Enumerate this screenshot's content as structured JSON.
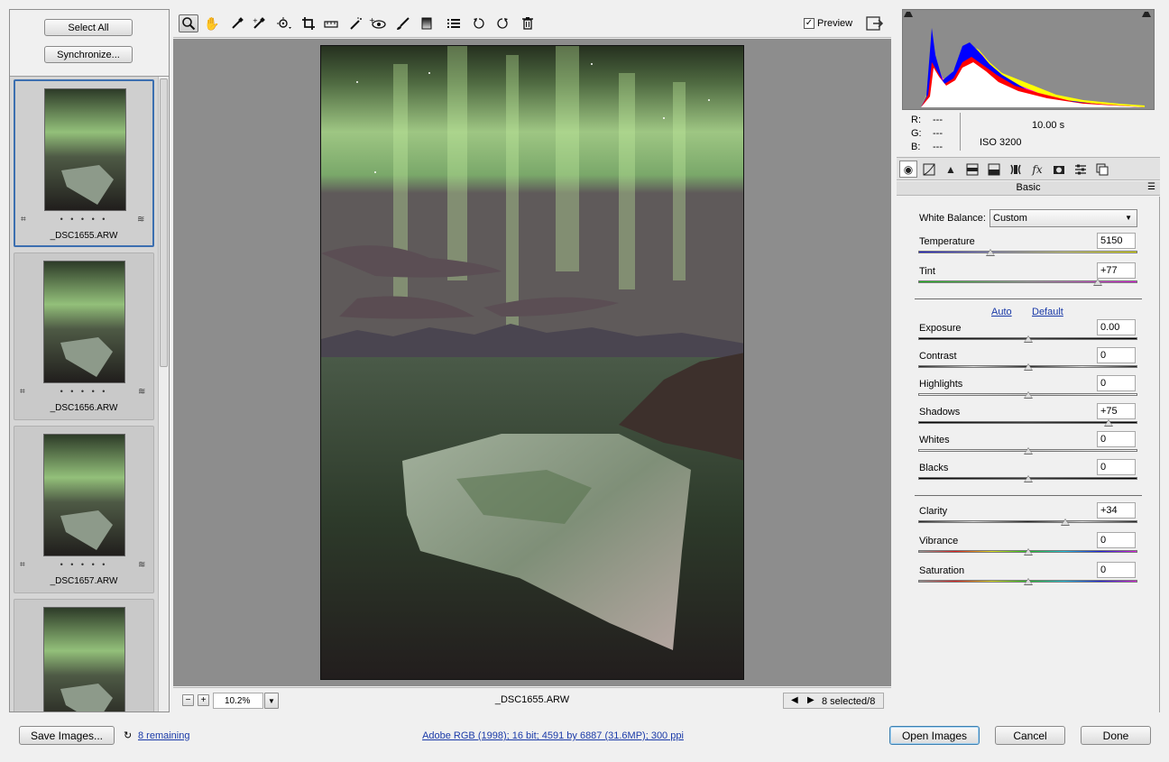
{
  "filmstrip": {
    "select_all": "Select All",
    "synchronize": "Synchronize...",
    "items": [
      {
        "name": "_DSC1655.ARW",
        "rating": "• • • • •",
        "selected": true
      },
      {
        "name": "_DSC1656.ARW",
        "rating": "• • • • •",
        "selected": false
      },
      {
        "name": "_DSC1657.ARW",
        "rating": "• • • • •",
        "selected": false
      },
      {
        "name": "",
        "rating": "",
        "selected": false
      }
    ]
  },
  "toolbar": {
    "preview_label": "Preview",
    "preview_checked": true,
    "tools": [
      "zoom-icon",
      "hand-icon",
      "white-balance-icon",
      "color-sampler-icon",
      "targeted-adjustment-icon",
      "crop-icon",
      "straighten-icon",
      "spot-removal-icon",
      "red-eye-icon",
      "adjustment-brush-icon",
      "graduated-filter-icon",
      "preferences-icon",
      "rotate-left-icon",
      "rotate-right-icon",
      "trash-icon"
    ]
  },
  "status": {
    "zoom": "10.2%",
    "filename": "_DSC1655.ARW",
    "selection": "8 selected/8"
  },
  "info": {
    "r_label": "R:",
    "r_val": "---",
    "g_label": "G:",
    "g_val": "---",
    "b_label": "B:",
    "b_val": "---",
    "shutter": "10.00 s",
    "iso": "ISO 3200"
  },
  "panel": {
    "title": "Basic",
    "white_balance_label": "White Balance:",
    "white_balance_value": "Custom",
    "auto_link": "Auto",
    "default_link": "Default",
    "sliders": [
      {
        "label": "Temperature",
        "value": "5150",
        "pos": 0.33,
        "track": "temp"
      },
      {
        "label": "Tint",
        "value": "+77",
        "pos": 0.82,
        "track": "tint"
      },
      {
        "label": "Exposure",
        "value": "0.00",
        "pos": 0.5,
        "track": "dark"
      },
      {
        "label": "Contrast",
        "value": "0",
        "pos": 0.5,
        "track": "contrast"
      },
      {
        "label": "Highlights",
        "value": "0",
        "pos": 0.5,
        "track": "light"
      },
      {
        "label": "Shadows",
        "value": "+75",
        "pos": 0.87,
        "track": "dark"
      },
      {
        "label": "Whites",
        "value": "0",
        "pos": 0.5,
        "track": "light"
      },
      {
        "label": "Blacks",
        "value": "0",
        "pos": 0.5,
        "track": "dark"
      },
      {
        "label": "Clarity",
        "value": "+34",
        "pos": 0.67,
        "track": "contrast"
      },
      {
        "label": "Vibrance",
        "value": "0",
        "pos": 0.5,
        "track": "rainbow"
      },
      {
        "label": "Saturation",
        "value": "0",
        "pos": 0.5,
        "track": "rainbow"
      }
    ]
  },
  "bottom": {
    "save_images": "Save Images...",
    "remaining": "8 remaining",
    "workflow": "Adobe RGB (1998); 16 bit; 4591 by 6887 (31.6MP); 300 ppi",
    "open_images": "Open Images",
    "cancel": "Cancel",
    "done": "Done"
  }
}
